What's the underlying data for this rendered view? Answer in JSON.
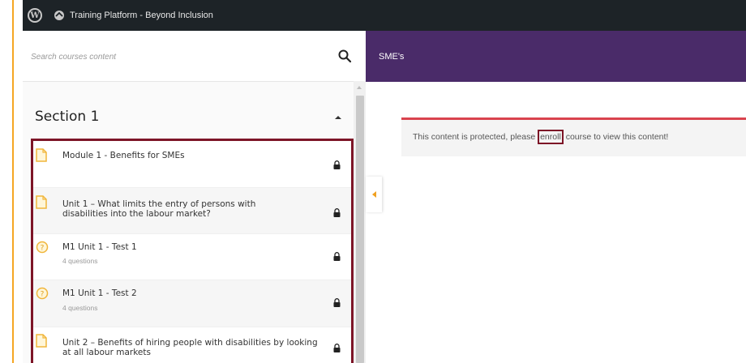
{
  "admin_bar": {
    "site_title": "Training Platform - Beyond Inclusion",
    "wp_logo_icon": "wordpress-logo-icon",
    "site_icon": "dashboard-icon"
  },
  "sidebar": {
    "search_placeholder": "Search courses content",
    "search_icon": "search-icon",
    "section": {
      "title": "Section 1",
      "collapse_icon": "caret-up-icon"
    },
    "items": [
      {
        "type": "lesson",
        "icon": "document-icon",
        "title": "Module 1 - Benefits for SMEs",
        "subtitle": "",
        "lock_icon": "lock-icon"
      },
      {
        "type": "lesson",
        "icon": "document-icon",
        "title": "Unit 1 – What limits the entry of persons with disabilities into the labour market?",
        "subtitle": "",
        "lock_icon": "lock-icon"
      },
      {
        "type": "quiz",
        "icon": "question-icon",
        "title": "M1 Unit 1 - Test 1",
        "subtitle": "4 questions",
        "lock_icon": "lock-icon"
      },
      {
        "type": "quiz",
        "icon": "question-icon",
        "title": "M1 Unit 1 - Test 2",
        "subtitle": "4 questions",
        "lock_icon": "lock-icon"
      },
      {
        "type": "lesson",
        "icon": "document-icon",
        "title": "Unit 2 – Benefits of hiring people with disabilities by looking at all labour markets",
        "subtitle": "",
        "lock_icon": "lock-icon"
      }
    ]
  },
  "content": {
    "header_title": "SME's",
    "notice_before": "This content is protected, please ",
    "notice_link": "enroll",
    "notice_after": " course to view this content!"
  },
  "colors": {
    "accent_orange": "#f5a623",
    "header_purple": "#4a2b69",
    "highlight_red": "#7d1527",
    "notice_red": "#d9434e"
  }
}
